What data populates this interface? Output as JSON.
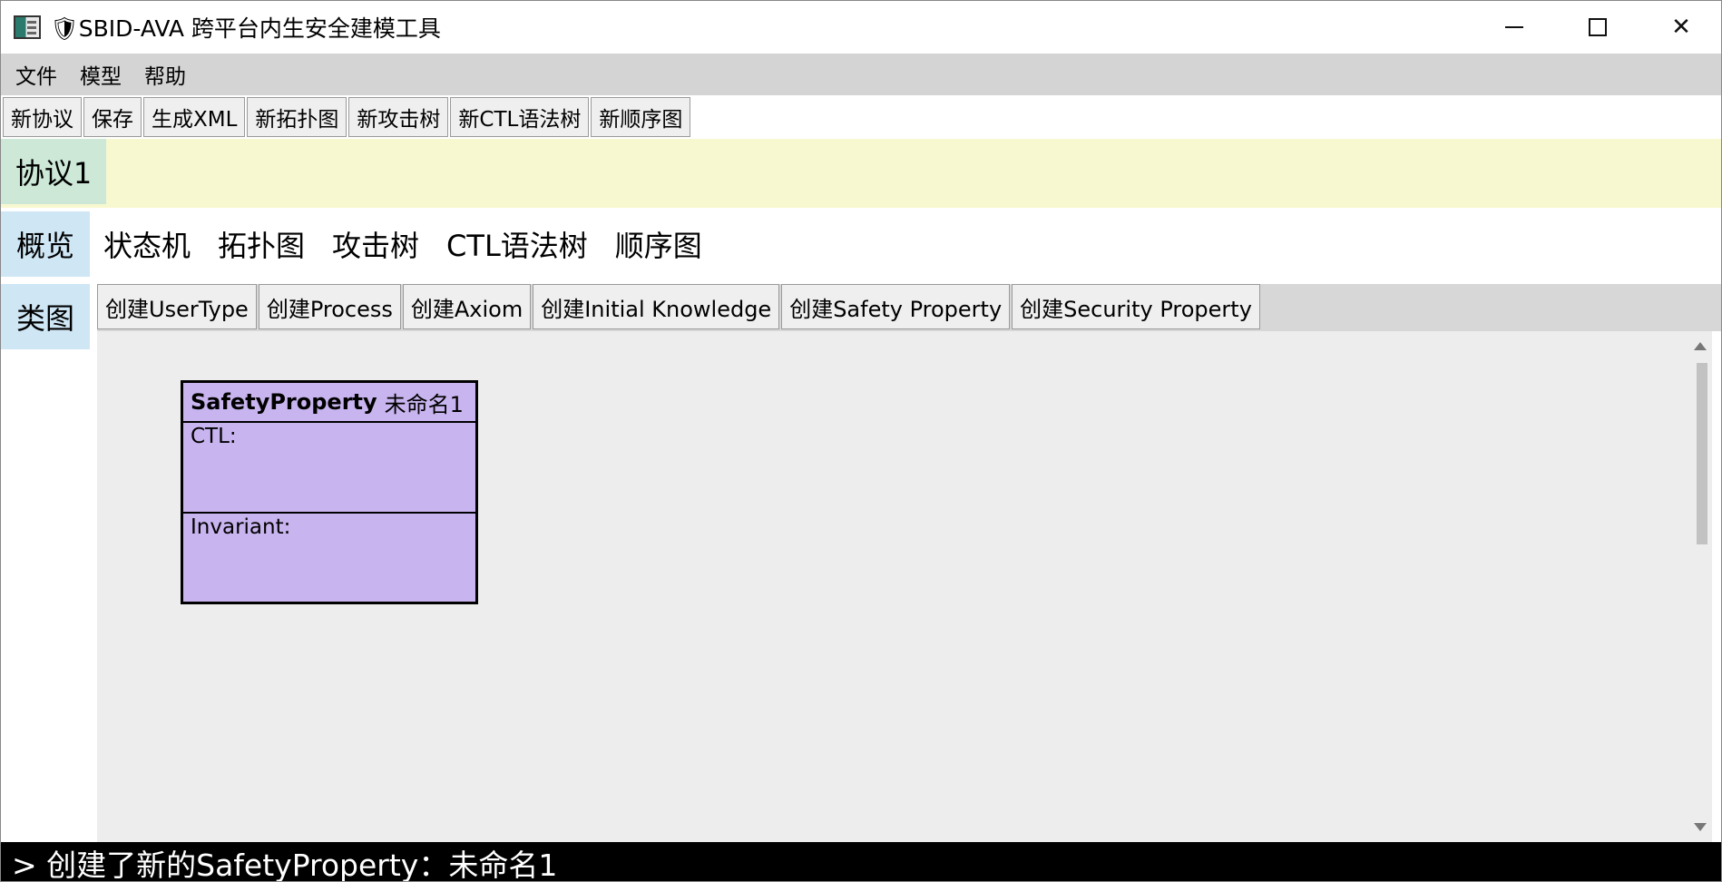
{
  "window": {
    "title": "🛡SBID-AVA 跨平台内生安全建模工具",
    "close_glyph": "✕"
  },
  "menu": [
    "文件",
    "模型",
    "帮助"
  ],
  "toolbar": [
    "新协议",
    "保存",
    "生成XML",
    "新拓扑图",
    "新攻击树",
    "新CTL语法树",
    "新顺序图"
  ],
  "protocol_tabs": [
    "协议1"
  ],
  "view_tabs": [
    {
      "label": "概览",
      "active": true
    },
    {
      "label": "状态机",
      "active": false
    },
    {
      "label": "拓扑图",
      "active": false
    },
    {
      "label": "攻击树",
      "active": false
    },
    {
      "label": "CTL语法树",
      "active": false
    },
    {
      "label": "顺序图",
      "active": false
    }
  ],
  "side_tabs": [
    "类图"
  ],
  "create_buttons": [
    "创建UserType",
    "创建Process",
    "创建Axiom",
    "创建Initial Knowledge",
    "创建Safety Property",
    "创建Security Property"
  ],
  "node": {
    "type": "SafetyProperty",
    "name": "未命名1",
    "ctl_label": "CTL:",
    "invariant_label": "Invariant:",
    "fill_color": "#c8b4ee"
  },
  "console": {
    "message": "> 创建了新的SafetyProperty：未命名1"
  },
  "colors": {
    "menubar": "#d4d4d4",
    "protocol_row": "#f8f8d0",
    "protocol_tab": "#cde8d7",
    "view_tab_active": "#cfe6f4",
    "canvas": "#ededed",
    "console": "#000000"
  }
}
